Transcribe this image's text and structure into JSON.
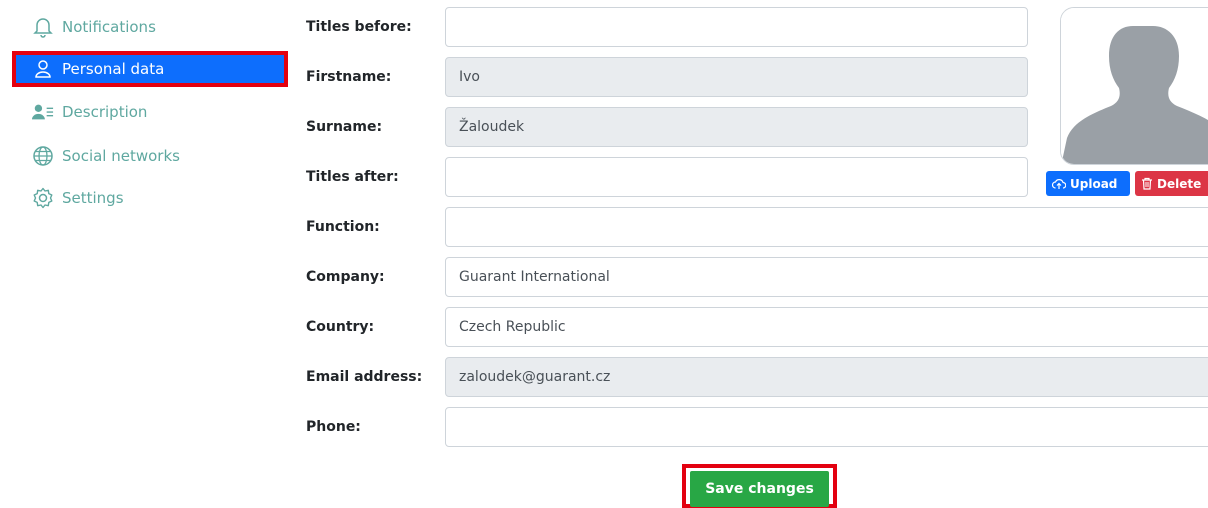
{
  "sidebar": {
    "items": [
      {
        "label": "Notifications",
        "icon": "bell-icon"
      },
      {
        "label": "Personal data",
        "icon": "user-icon"
      },
      {
        "label": "Description",
        "icon": "user-description-icon"
      },
      {
        "label": "Social networks",
        "icon": "globe-icon"
      },
      {
        "label": "Settings",
        "icon": "gear-icon"
      }
    ],
    "active_index": 1
  },
  "form": {
    "titles_before": {
      "label": "Titles before:",
      "value": ""
    },
    "firstname": {
      "label": "Firstname:",
      "value": "Ivo"
    },
    "surname": {
      "label": "Surname:",
      "value": "Žaloudek"
    },
    "titles_after": {
      "label": "Titles after:",
      "value": ""
    },
    "function": {
      "label": "Function:",
      "value": ""
    },
    "company": {
      "label": "Company:",
      "value": "Guarant International"
    },
    "country": {
      "label": "Country:",
      "value": "Czech Republic"
    },
    "email": {
      "label": "Email address:",
      "value": "zaloudek@guarant.cz"
    },
    "phone": {
      "label": "Phone:",
      "value": ""
    }
  },
  "photo": {
    "upload_label": "Upload",
    "delete_label": "Delete"
  },
  "save_label": "Save changes",
  "colors": {
    "accent": "#0d6efd",
    "highlight": "#e3000f",
    "success": "#28a745",
    "danger": "#dc3545",
    "nav_text": "#5fa8a0"
  }
}
